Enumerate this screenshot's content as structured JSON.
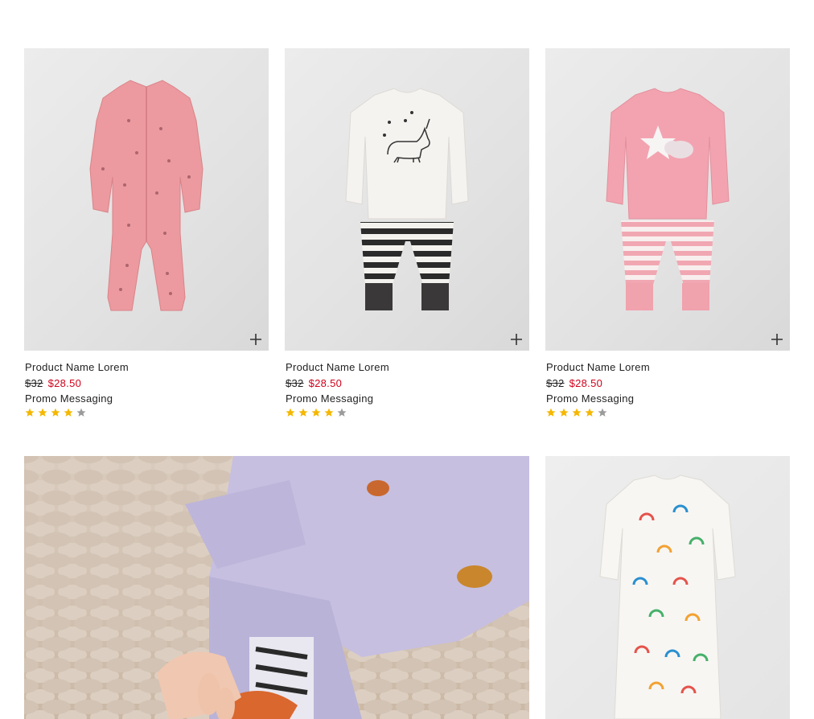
{
  "products": [
    {
      "name": "Product Name Lorem",
      "price_was": "$32",
      "price_now": "$28.50",
      "promo": "Promo Messaging",
      "rating": 4,
      "image": "pink-footed-sleeper-horses",
      "quick_add_icon": "plus-icon"
    },
    {
      "name": "Product Name Lorem",
      "price_was": "$32",
      "price_now": "$28.50",
      "promo": "Promo Messaging",
      "rating": 4,
      "image": "white-unicorn-top-striped-pants-set",
      "quick_add_icon": "plus-icon"
    },
    {
      "name": "Product Name Lorem",
      "price_was": "$32",
      "price_now": "$28.50",
      "promo": "Promo Messaging",
      "rating": 4,
      "image": "pink-star-top-striped-pants-set",
      "quick_add_icon": "plus-icon"
    }
  ],
  "lifestyle": {
    "image": "baby-in-lavender-pajamas-on-knit-blanket"
  },
  "product_4": {
    "image": "white-rainbow-print-gown"
  },
  "colors": {
    "sale_price": "#d0021b",
    "star_filled": "#f5b700",
    "star_empty": "#9b9b9b",
    "text": "#222222"
  }
}
